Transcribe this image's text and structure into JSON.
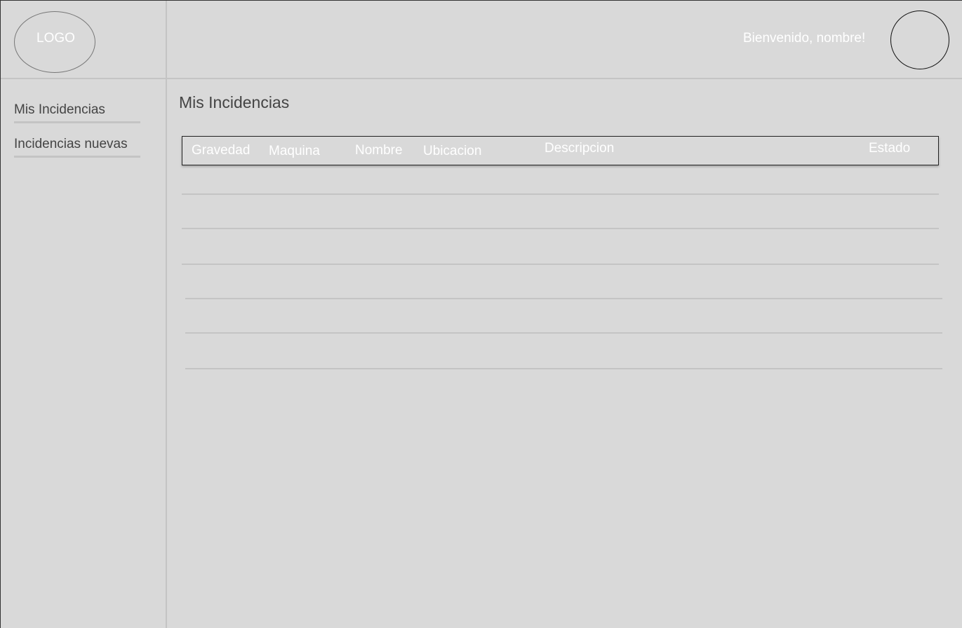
{
  "header": {
    "logo_text": "LOGO",
    "welcome_text": "Bienvenido, nombre!"
  },
  "sidebar": {
    "items": [
      {
        "label": "Mis Incidencias"
      },
      {
        "label": "Incidencias nuevas"
      }
    ]
  },
  "main": {
    "title": "Mis Incidencias",
    "table": {
      "columns": [
        "Gravedad",
        "Maquina",
        "Nombre",
        "Ubicacion",
        "Descripcion",
        "Estado"
      ],
      "rows": []
    }
  }
}
